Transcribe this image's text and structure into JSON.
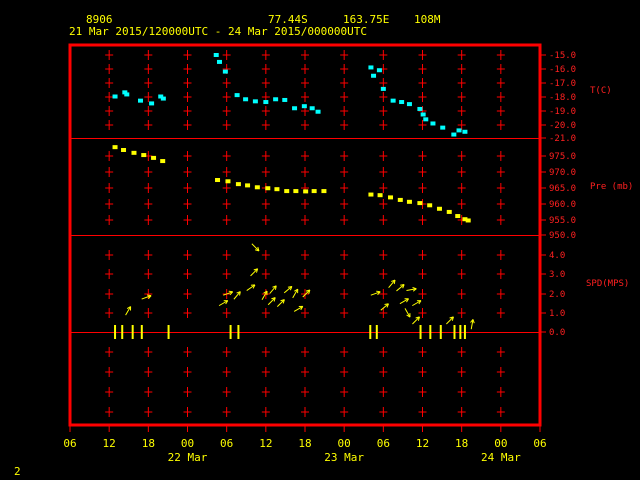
{
  "header": {
    "station_id": "8906",
    "latitude": "77.44S",
    "longitude": "163.75E",
    "elevation": "108M",
    "time_range": "21 Mar 2015/120000UTC - 24 Mar 2015/000000UTC"
  },
  "page_number": "2",
  "colors": {
    "frame": "#ff0000",
    "temperature": "#00ffff",
    "pressure": "#ffff00",
    "wind": "#ffff00",
    "axis_text": "#ff2020",
    "header_text": "#ffff00"
  },
  "chart_data": {
    "type": "scatter",
    "x_unit": "hours since 21 Mar 2015 06UTC",
    "x_tick_labels": [
      "06",
      "12",
      "18",
      "00",
      "06",
      "12",
      "18",
      "00",
      "06",
      "12",
      "18",
      "00",
      "06"
    ],
    "x_range": [
      0,
      72
    ],
    "date_labels": [
      {
        "text": "22 Mar",
        "x": 18
      },
      {
        "text": "23 Mar",
        "x": 42
      },
      {
        "text": "24 Mar",
        "x": 66
      }
    ],
    "panels": [
      {
        "name": "temperature",
        "label": "T(C)",
        "ticks": [
          "-15.0",
          "-16.0",
          "-17.0",
          "-18.0",
          "-19.0",
          "-20.0",
          "-21.0"
        ],
        "ylim": [
          -21,
          -15
        ],
        "points": [
          {
            "x": 6.9,
            "y": -18.0
          },
          {
            "x": 8.4,
            "y": -17.7
          },
          {
            "x": 8.7,
            "y": -17.85
          },
          {
            "x": 10.8,
            "y": -18.3
          },
          {
            "x": 12.5,
            "y": -18.5
          },
          {
            "x": 13.9,
            "y": -18.0
          },
          {
            "x": 14.3,
            "y": -18.15
          },
          {
            "x": 22.4,
            "y": -15.0
          },
          {
            "x": 22.9,
            "y": -15.5
          },
          {
            "x": 23.8,
            "y": -16.2
          },
          {
            "x": 25.6,
            "y": -17.9
          },
          {
            "x": 26.9,
            "y": -18.2
          },
          {
            "x": 28.4,
            "y": -18.35
          },
          {
            "x": 30.0,
            "y": -18.4
          },
          {
            "x": 31.5,
            "y": -18.2
          },
          {
            "x": 32.9,
            "y": -18.25
          },
          {
            "x": 34.4,
            "y": -18.85
          },
          {
            "x": 35.9,
            "y": -18.7
          },
          {
            "x": 37.1,
            "y": -18.85
          },
          {
            "x": 38.0,
            "y": -19.1
          },
          {
            "x": 46.1,
            "y": -15.9
          },
          {
            "x": 47.4,
            "y": -16.1
          },
          {
            "x": 46.5,
            "y": -16.5
          },
          {
            "x": 48.0,
            "y": -17.45
          },
          {
            "x": 49.5,
            "y": -18.3
          },
          {
            "x": 50.8,
            "y": -18.4
          },
          {
            "x": 52.0,
            "y": -18.55
          },
          {
            "x": 53.6,
            "y": -18.9
          },
          {
            "x": 54.1,
            "y": -19.3
          },
          {
            "x": 54.5,
            "y": -19.65
          },
          {
            "x": 55.6,
            "y": -19.95
          },
          {
            "x": 57.1,
            "y": -20.25
          },
          {
            "x": 58.8,
            "y": -20.75
          },
          {
            "x": 59.6,
            "y": -20.45
          },
          {
            "x": 60.5,
            "y": -20.55
          }
        ]
      },
      {
        "name": "pressure",
        "label": "Pre (mb)",
        "ticks": [
          "975.0",
          "970.0",
          "965.0",
          "960.0",
          "955.0",
          "950.0"
        ],
        "ylim": [
          950,
          980
        ],
        "top_label": "",
        "points": [
          {
            "x": 6.9,
            "y": 977.8
          },
          {
            "x": 8.2,
            "y": 976.9
          },
          {
            "x": 9.8,
            "y": 976.0
          },
          {
            "x": 11.3,
            "y": 975.3
          },
          {
            "x": 12.8,
            "y": 974.4
          },
          {
            "x": 14.2,
            "y": 973.4
          },
          {
            "x": 22.6,
            "y": 967.4
          },
          {
            "x": 24.2,
            "y": 967.0
          },
          {
            "x": 25.8,
            "y": 966.1
          },
          {
            "x": 27.2,
            "y": 965.7
          },
          {
            "x": 28.7,
            "y": 965.1
          },
          {
            "x": 30.3,
            "y": 964.8
          },
          {
            "x": 31.7,
            "y": 964.5
          },
          {
            "x": 33.2,
            "y": 963.9
          },
          {
            "x": 34.6,
            "y": 963.9
          },
          {
            "x": 36.1,
            "y": 963.8
          },
          {
            "x": 37.4,
            "y": 963.9
          },
          {
            "x": 38.9,
            "y": 963.9
          },
          {
            "x": 46.1,
            "y": 962.8
          },
          {
            "x": 47.5,
            "y": 962.6
          },
          {
            "x": 49.1,
            "y": 961.9
          },
          {
            "x": 50.6,
            "y": 961.1
          },
          {
            "x": 52.0,
            "y": 960.5
          },
          {
            "x": 53.6,
            "y": 960.1
          },
          {
            "x": 55.1,
            "y": 959.4
          },
          {
            "x": 56.6,
            "y": 958.3
          },
          {
            "x": 58.1,
            "y": 957.3
          },
          {
            "x": 59.4,
            "y": 956.0
          },
          {
            "x": 60.5,
            "y": 955.0
          },
          {
            "x": 61.0,
            "y": 954.6
          }
        ]
      },
      {
        "name": "wind",
        "label": "SPD(MPS)",
        "ticks": [
          "4.0",
          "3.0",
          "2.0",
          "1.0",
          "0.0"
        ],
        "ylim": [
          0,
          4.6
        ],
        "arrows": [
          {
            "x": 8.9,
            "y": 1.1,
            "dir": 60
          },
          {
            "x": 11.7,
            "y": 1.8,
            "dir": 20
          },
          {
            "x": 23.5,
            "y": 1.5,
            "dir": 30
          },
          {
            "x": 24.2,
            "y": 2.0,
            "dir": 20
          },
          {
            "x": 25.6,
            "y": 1.9,
            "dir": 50
          },
          {
            "x": 27.7,
            "y": 2.3,
            "dir": 35
          },
          {
            "x": 28.4,
            "y": 4.4,
            "dir": -45
          },
          {
            "x": 28.2,
            "y": 3.1,
            "dir": 45
          },
          {
            "x": 29.8,
            "y": 1.9,
            "dir": 60
          },
          {
            "x": 30.9,
            "y": 1.6,
            "dir": 45
          },
          {
            "x": 31.1,
            "y": 2.2,
            "dir": 50
          },
          {
            "x": 32.3,
            "y": 1.5,
            "dir": 45
          },
          {
            "x": 33.4,
            "y": 2.2,
            "dir": 40
          },
          {
            "x": 34.5,
            "y": 2.0,
            "dir": 60
          },
          {
            "x": 35.0,
            "y": 1.2,
            "dir": 30
          },
          {
            "x": 36.2,
            "y": 2.0,
            "dir": 45
          },
          {
            "x": 46.8,
            "y": 2.0,
            "dir": 20
          },
          {
            "x": 48.2,
            "y": 1.3,
            "dir": 40
          },
          {
            "x": 49.3,
            "y": 2.5,
            "dir": 50
          },
          {
            "x": 50.6,
            "y": 2.3,
            "dir": 40
          },
          {
            "x": 51.2,
            "y": 1.6,
            "dir": 30
          },
          {
            "x": 51.7,
            "y": 1.0,
            "dir": -60
          },
          {
            "x": 52.3,
            "y": 2.2,
            "dir": 10
          },
          {
            "x": 53.1,
            "y": 1.5,
            "dir": 30
          },
          {
            "x": 53.0,
            "y": 0.6,
            "dir": 45
          },
          {
            "x": 58.2,
            "y": 0.6,
            "dir": 45
          },
          {
            "x": 61.6,
            "y": 0.4,
            "dir": 80
          }
        ],
        "calm_marks": [
          6.9,
          8.0,
          9.6,
          11.0,
          15.1,
          24.6,
          25.8,
          46.0,
          47.0,
          53.7,
          55.2,
          56.8,
          58.9,
          59.8,
          60.5
        ]
      }
    ]
  }
}
